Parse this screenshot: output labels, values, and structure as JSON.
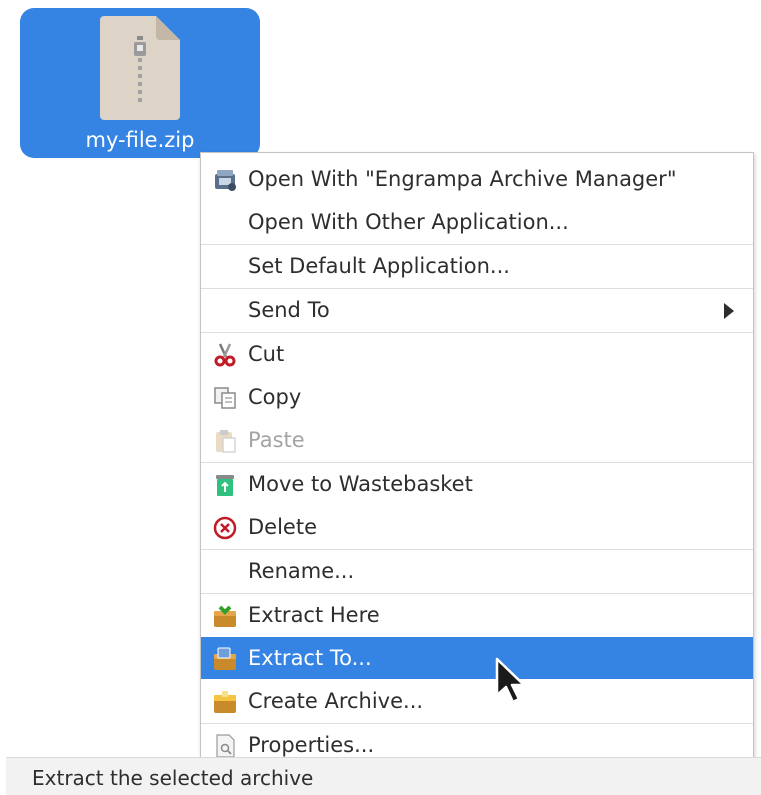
{
  "desktop": {
    "file": {
      "name": "my-file.zip",
      "icon": "zip-archive-icon",
      "selected": true
    }
  },
  "context_menu": {
    "items": [
      {
        "label": "Open With \"Engrampa Archive Manager\"",
        "icon": "engrampa-icon"
      },
      {
        "label": "Open With Other Application..."
      },
      {
        "label": "Set Default Application..."
      },
      {
        "label": "Send To",
        "has_submenu": true
      },
      {
        "label": "Cut",
        "icon": "scissors-icon"
      },
      {
        "label": "Copy",
        "icon": "copy-icon"
      },
      {
        "label": "Paste",
        "icon": "paste-icon",
        "disabled": true
      },
      {
        "label": "Move to Wastebasket",
        "icon": "wastebasket-icon"
      },
      {
        "label": "Delete",
        "icon": "delete-icon"
      },
      {
        "label": "Rename..."
      },
      {
        "label": "Extract Here",
        "icon": "extract-here-icon"
      },
      {
        "label": "Extract To...",
        "icon": "extract-to-icon",
        "selected": true
      },
      {
        "label": "Create Archive...",
        "icon": "create-archive-icon"
      },
      {
        "label": "Properties...",
        "icon": "properties-icon"
      }
    ]
  },
  "statusbar": {
    "text": "Extract the selected archive"
  },
  "colors": {
    "selection": "#3584e4",
    "disabled_text": "#a3a3a3",
    "text": "#2e2e2e"
  }
}
